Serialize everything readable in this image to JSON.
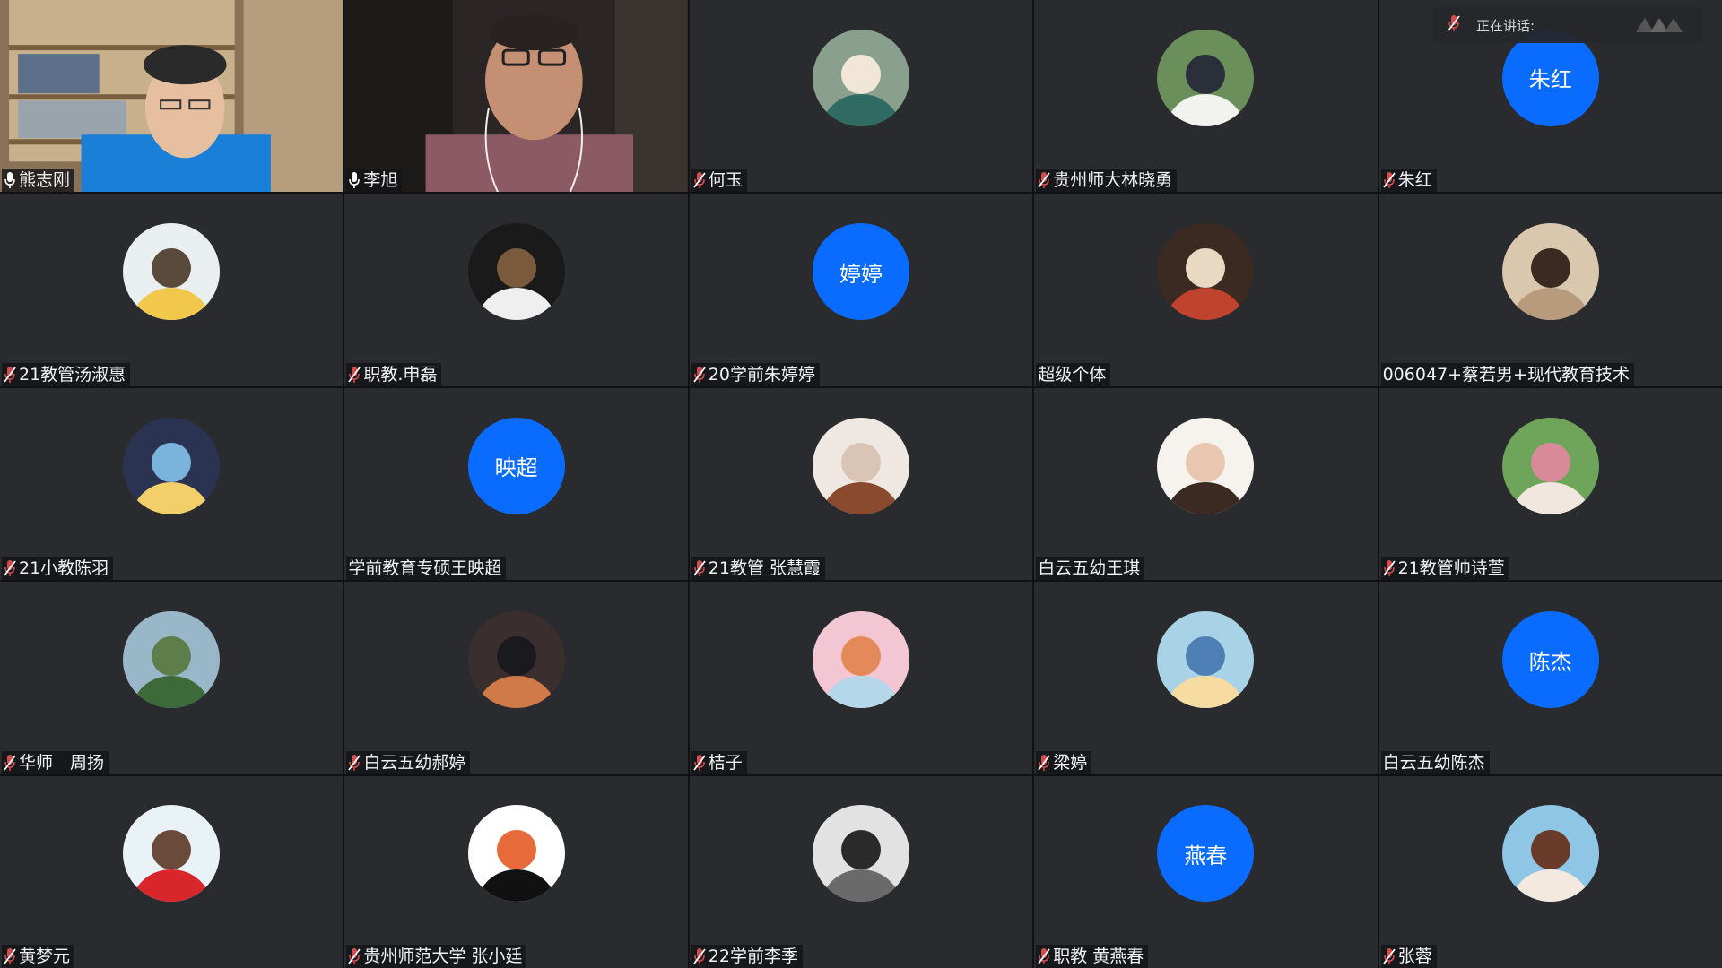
{
  "meeting": {
    "speaking_label": "正在讲话:",
    "speaking_name": ""
  },
  "participants": [
    {
      "name": "熊志刚",
      "mic": "on",
      "kind": "video"
    },
    {
      "name": "李旭",
      "mic": "on",
      "kind": "video"
    },
    {
      "name": "何玉",
      "mic": "muted",
      "kind": "photo",
      "palette": [
        "#8aa08f",
        "#2f6b63",
        "#f1e6d8"
      ]
    },
    {
      "name": "贵州师大林晓勇",
      "mic": "muted",
      "kind": "photo",
      "palette": [
        "#6a8f5a",
        "#f2f2ee",
        "#2b2f3a"
      ]
    },
    {
      "name": "朱红",
      "mic": "muted",
      "kind": "text",
      "avatar_text": "朱红"
    },
    {
      "name": "21教管汤淑惠",
      "mic": "muted",
      "kind": "photo",
      "palette": [
        "#e9eef0",
        "#f1c84b",
        "#5a4a3c"
      ]
    },
    {
      "name": "职教.申磊",
      "mic": "muted",
      "kind": "photo",
      "palette": [
        "#1a1a1a",
        "#efefef",
        "#7a5a3c"
      ]
    },
    {
      "name": "20学前朱婷婷",
      "mic": "muted",
      "kind": "text",
      "avatar_text": "婷婷"
    },
    {
      "name": "超级个体",
      "mic": "none",
      "kind": "photo",
      "palette": [
        "#3a2a22",
        "#c0432e",
        "#e9d8c2"
      ]
    },
    {
      "name": "006047+蔡若男+现代教育技术",
      "mic": "none",
      "kind": "photo",
      "palette": [
        "#d9c7ae",
        "#b89a7c",
        "#3b2a22"
      ]
    },
    {
      "name": "21小教陈羽",
      "mic": "muted",
      "kind": "photo",
      "palette": [
        "#2b3352",
        "#f3cf6a",
        "#7ab3dc"
      ]
    },
    {
      "name": "学前教育专硕王映超",
      "mic": "none",
      "kind": "text",
      "avatar_text": "映超"
    },
    {
      "name": "21教管 张慧霞",
      "mic": "muted",
      "kind": "photo",
      "palette": [
        "#efe8e2",
        "#8a4a2e",
        "#d9c4b6"
      ]
    },
    {
      "name": "白云五幼王琪",
      "mic": "none",
      "kind": "photo",
      "palette": [
        "#f6f2ee",
        "#3a2a22",
        "#e9c6b0"
      ]
    },
    {
      "name": "21教管帅诗萱",
      "mic": "muted",
      "kind": "photo",
      "palette": [
        "#6fa55a",
        "#f2e6e0",
        "#d88a9a"
      ]
    },
    {
      "name": "华师　周扬",
      "mic": "muted",
      "kind": "photo",
      "palette": [
        "#9ab7c9",
        "#3e6a3a",
        "#5d7e4a"
      ]
    },
    {
      "name": "白云五幼郝婷",
      "mic": "muted",
      "kind": "photo",
      "palette": [
        "#3a2e2e",
        "#d07a4a",
        "#1a1a1e"
      ]
    },
    {
      "name": "桔子",
      "mic": "muted",
      "kind": "photo",
      "palette": [
        "#f3c6d4",
        "#b6d6e9",
        "#e48a5a"
      ]
    },
    {
      "name": "梁婷",
      "mic": "muted",
      "kind": "photo",
      "palette": [
        "#a8d2e6",
        "#f6dca0",
        "#4e7fb5"
      ]
    },
    {
      "name": "白云五幼陈杰",
      "mic": "none",
      "kind": "text",
      "avatar_text": "陈杰"
    },
    {
      "name": "黄梦元",
      "mic": "muted",
      "kind": "photo",
      "palette": [
        "#e9f2f6",
        "#d8262a",
        "#6a4a3a"
      ]
    },
    {
      "name": "贵州师范大学 张小廷",
      "mic": "muted",
      "kind": "photo",
      "palette": [
        "#ffffff",
        "#111111",
        "#e66a3a"
      ]
    },
    {
      "name": "22学前李季",
      "mic": "muted",
      "kind": "photo",
      "palette": [
        "#e2e2e2",
        "#6a6a6a",
        "#2a2a2a"
      ]
    },
    {
      "name": "职教 黄燕春",
      "mic": "muted",
      "kind": "text",
      "avatar_text": "燕春"
    },
    {
      "name": "张蓉",
      "mic": "muted",
      "kind": "photo",
      "palette": [
        "#8fc6e6",
        "#f4e9df",
        "#6a3a2a"
      ]
    }
  ]
}
